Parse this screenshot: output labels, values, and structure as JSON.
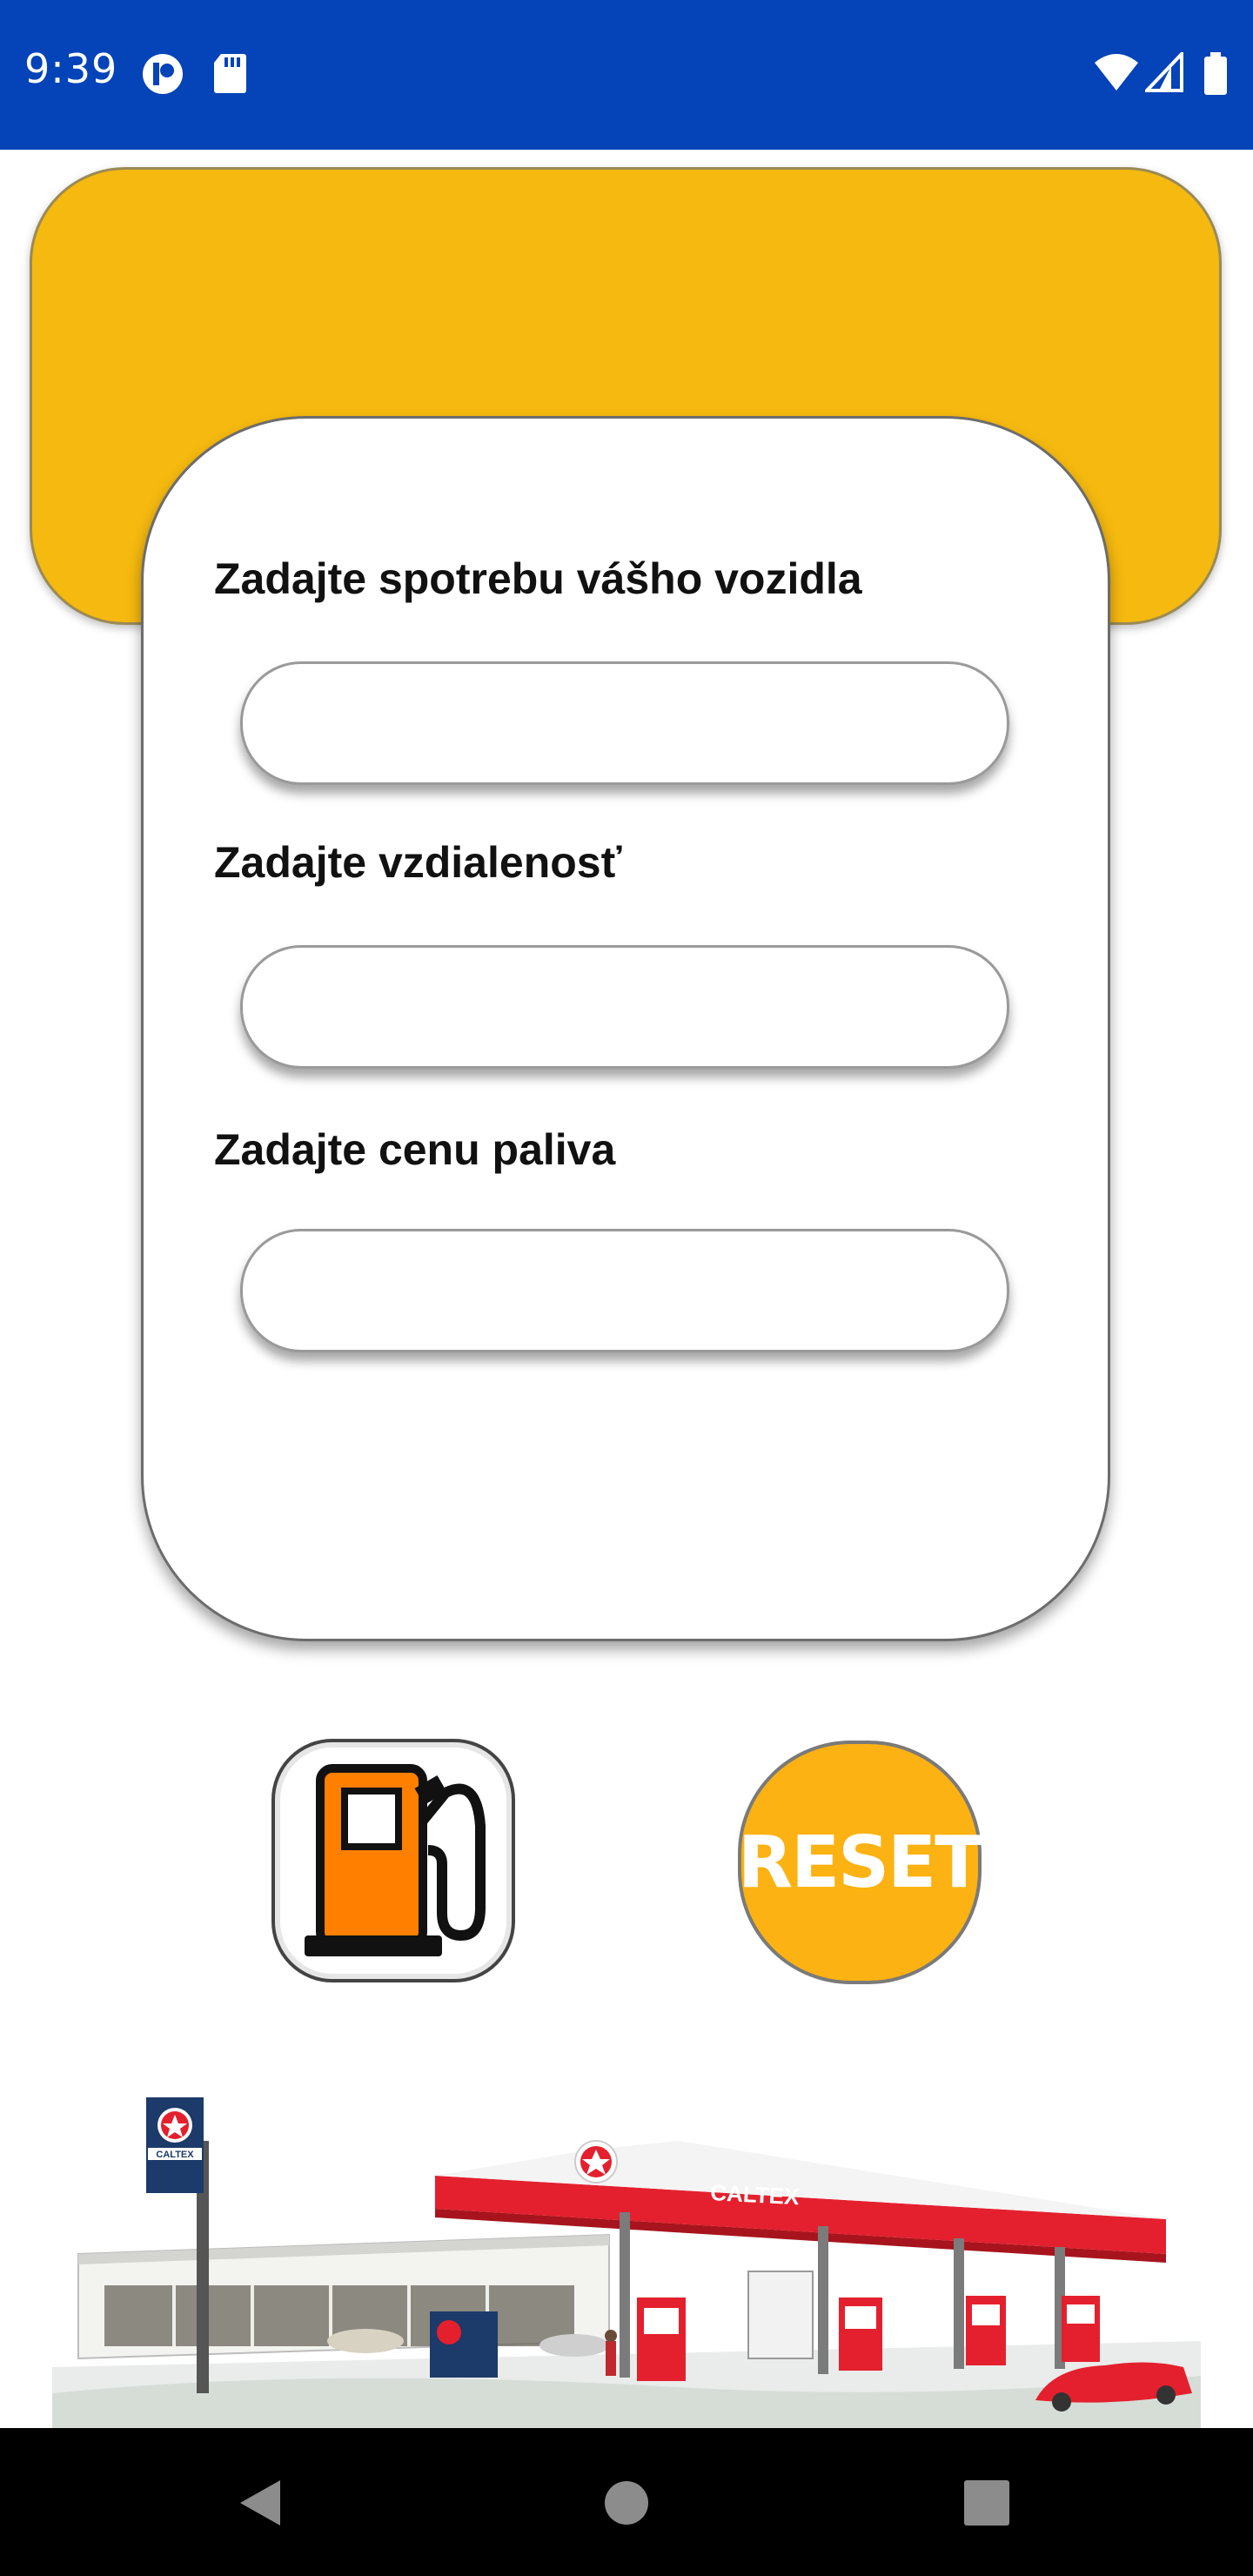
{
  "status_bar": {
    "time": "9:39",
    "icons_left": [
      "app-notification-icon",
      "sd-card-icon"
    ],
    "icons_right": [
      "wifi-icon",
      "cellular-signal-icon",
      "battery-icon"
    ]
  },
  "form": {
    "consumption_label": "Zadajte spotrebu vášho vozidla",
    "consumption_value": "",
    "distance_label": "Zadajte vzdialenosť",
    "distance_value": "",
    "price_label": "Zadajte cenu paliva",
    "price_value": ""
  },
  "buttons": {
    "calculate_icon": "fuel-pump-icon",
    "reset_label": "RESET"
  },
  "illustration": {
    "brand_text": "CALTEX"
  },
  "nav": {
    "back": "back-icon",
    "home": "home-icon",
    "recents": "recents-icon"
  },
  "colors": {
    "status_bar": "#0443b8",
    "banner": "#f5b90f",
    "reset": "#fcb212",
    "pump": "#ff7f00"
  }
}
